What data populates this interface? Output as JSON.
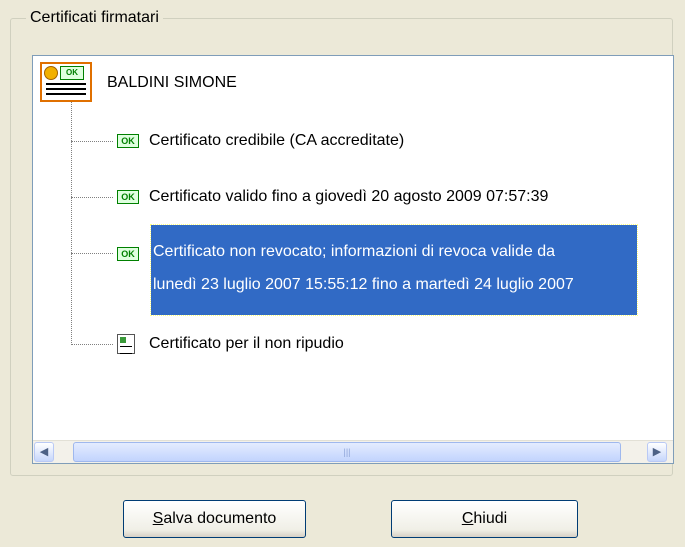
{
  "group": {
    "title": "Certificati firmatari"
  },
  "tree": {
    "root_label": "BALDINI SIMONE",
    "items": [
      {
        "icon": "ok-check-icon",
        "label": "Certificato credibile (CA accreditate)"
      },
      {
        "icon": "ok-check-icon",
        "label": "Certificato valido fino a giovedì 20 agosto 2009  07:57:39"
      },
      {
        "icon": "ok-check-icon",
        "line1": "Certificato non revocato; informazioni di revoca valide da",
        "line2": "lunedì 23 luglio 2007 15:55:12 fino a martedì 24 luglio 2007",
        "selected": true
      },
      {
        "icon": "document-icon",
        "label": "Certificato per il non ripudio"
      }
    ],
    "ok_text": "OK",
    "scroll_left": "◀",
    "scroll_right": "▶",
    "scroll_grip": "|||"
  },
  "buttons": {
    "save": {
      "mnemonic": "S",
      "rest": "alva documento"
    },
    "close": {
      "mnemonic": "C",
      "rest": "hiudi"
    }
  },
  "colors": {
    "selection": "#316ac5",
    "ok_green": "#008000",
    "window_bg": "#ece9d8"
  }
}
